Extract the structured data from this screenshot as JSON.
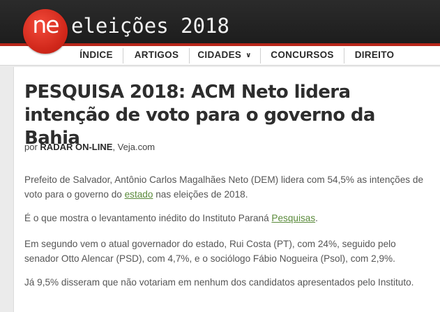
{
  "header": {
    "logo": "ne",
    "site_title": "eleições 2018",
    "colors": {
      "bar": "#222222",
      "logo_red": "#d0271a",
      "accent": "#b8261a",
      "link": "#5a8a3a"
    }
  },
  "nav": {
    "items": [
      {
        "label": "ÍNDICE"
      },
      {
        "label": "ARTIGOS"
      },
      {
        "label": "CIDADES",
        "dropdown": true
      },
      {
        "label": "CONCURSOS"
      },
      {
        "label": "DIREITO"
      }
    ],
    "chevron_icon": "chevron-down-icon"
  },
  "article": {
    "headline": "PESQUISA 2018: ACM Neto lidera intenção de voto para o governo da Bahia",
    "byline": {
      "prefix": "por",
      "author": "RADAR ON-LINE",
      "source": "Veja.com"
    },
    "p1_a": "Prefeito de Salvador, Antônio Carlos Magalhães Neto (DEM) lidera com 54,5% as intenções de voto para o governo do",
    "p1_link": "estado",
    "p1_b": "nas eleições de 2018.",
    "p2_a": "É o que mostra o levantamento inédito do Instituto Paraná",
    "p2_link": "Pesquisas",
    "p2_b": ".",
    "p3": "Em segundo vem o atual governador do estado, Rui Costa (PT), com  24%, seguido pelo senador Otto Alencar (PSD), com 4,7%, e o sociólogo Fábio Nogueira (Psol), com 2,9%.",
    "p4": "Já 9,5% disseram que não votariam em nenhum dos candidatos apresentados pelo Instituto."
  }
}
